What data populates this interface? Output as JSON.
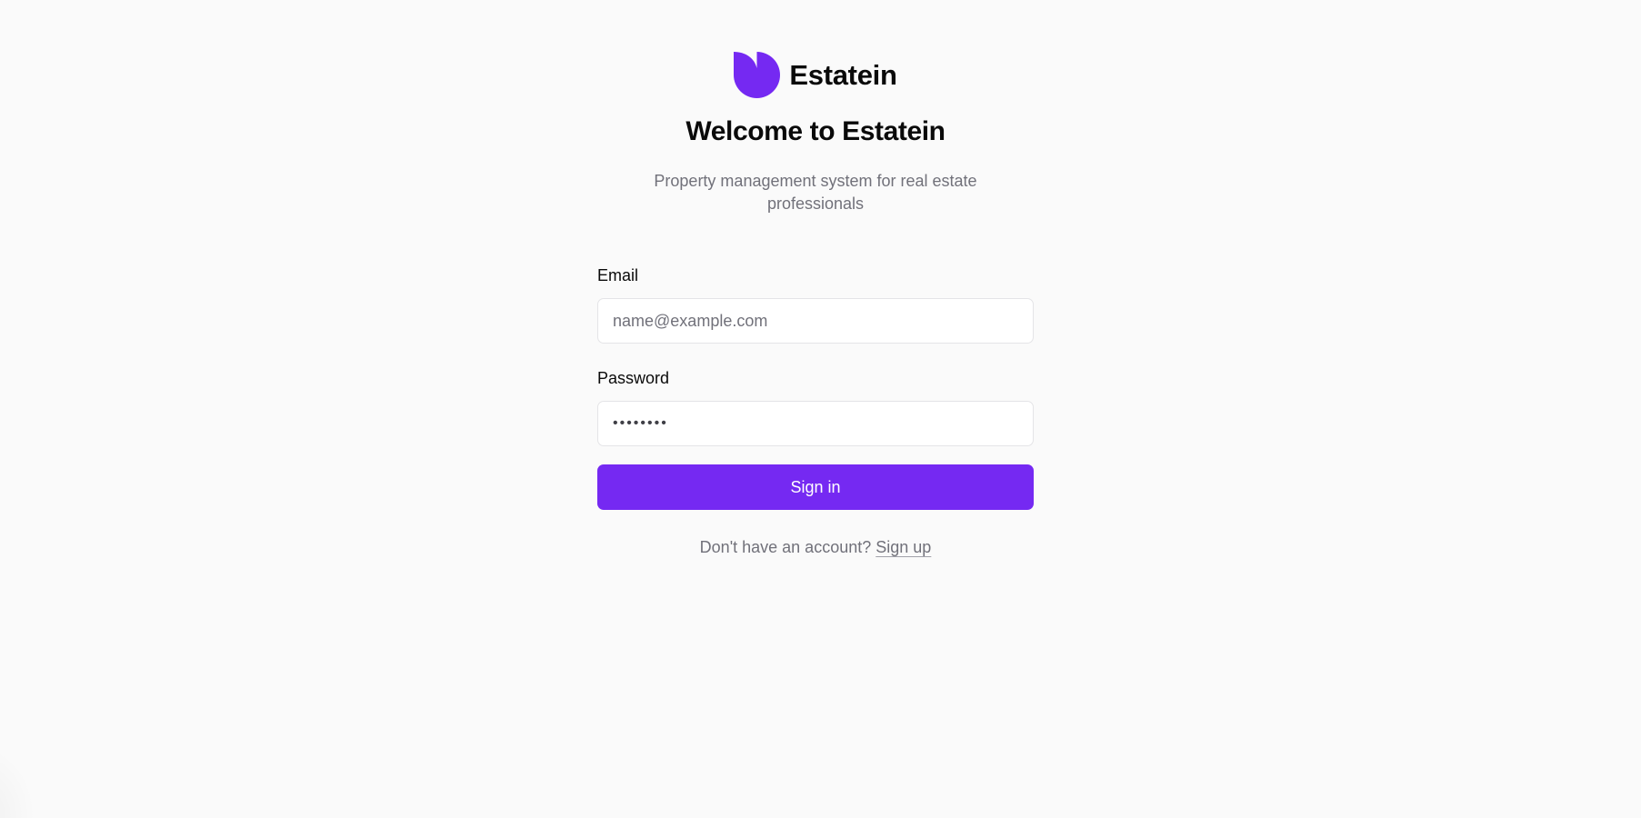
{
  "brand": {
    "name": "Estatein",
    "logo_icon": "leaf-logo-icon",
    "accent_color": "#7529f2"
  },
  "header": {
    "title": "Welcome to Estatein",
    "subtitle": "Property management system for real estate professionals"
  },
  "form": {
    "email_label": "Email",
    "email_placeholder": "name@example.com",
    "email_value": "",
    "password_label": "Password",
    "password_value": "••••••••",
    "submit_label": "Sign in"
  },
  "footer": {
    "prompt": "Don't have an account?",
    "signup_label": "Sign up"
  }
}
